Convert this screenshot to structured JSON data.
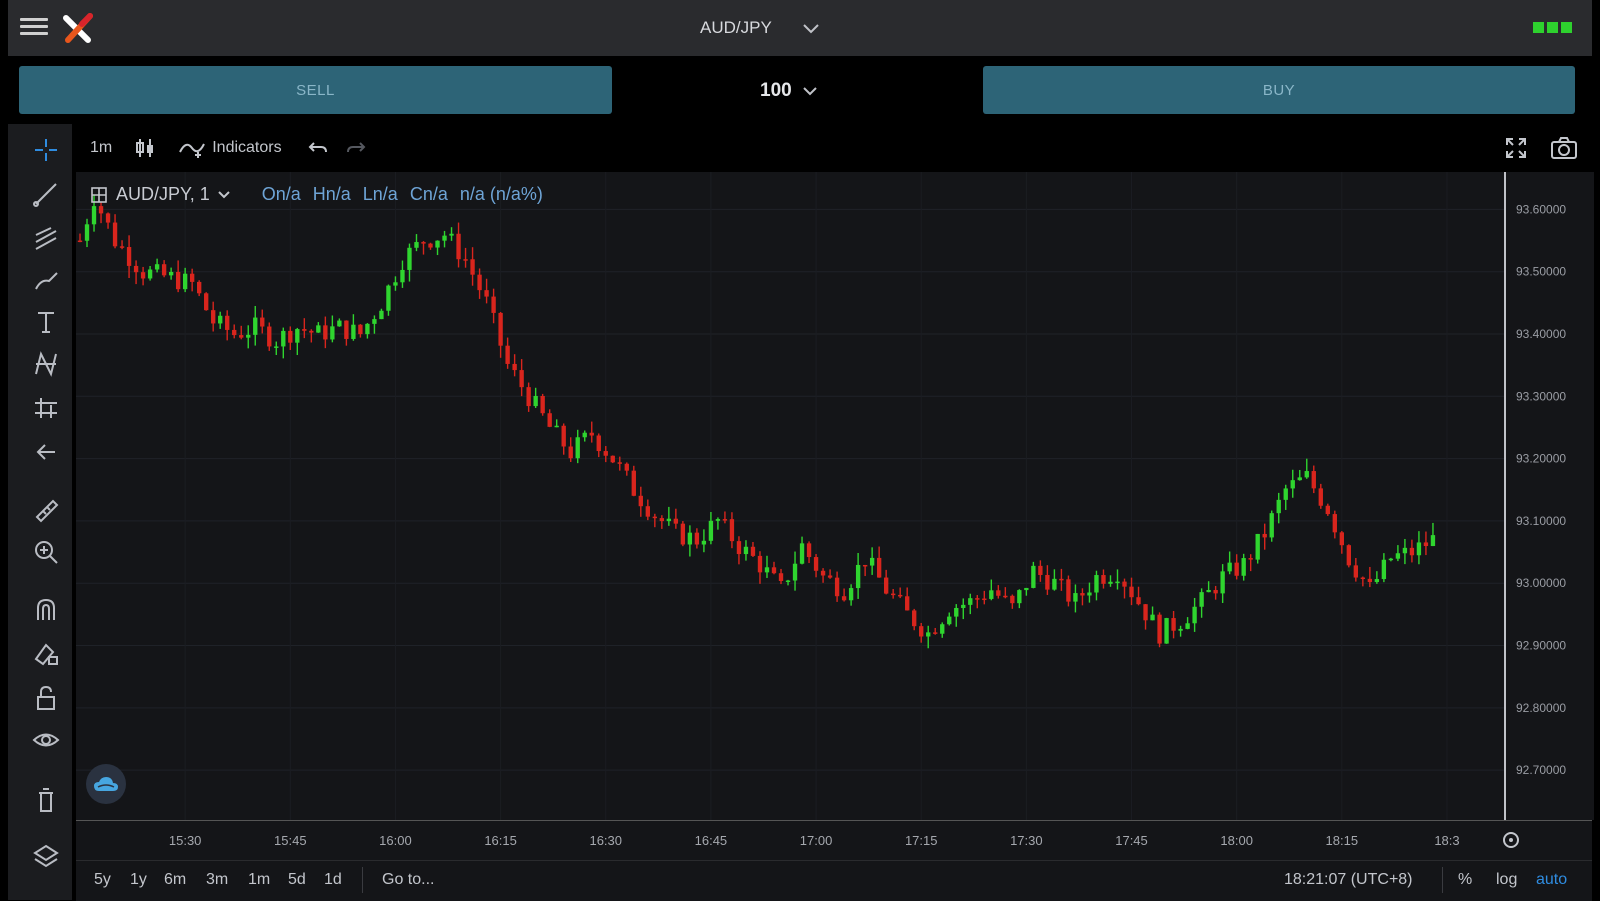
{
  "header": {
    "pair": "AUD/JPY",
    "colors": {
      "bar_bg": "#2a2b2e",
      "status": "#2ed12e"
    }
  },
  "trade": {
    "sell_label": "SELL",
    "buy_label": "BUY",
    "quantity": "100",
    "button_color": "#2d6477"
  },
  "chart_toolbar": {
    "interval": "1m",
    "indicators_label": "Indicators"
  },
  "legend": {
    "symbol": "AUD/JPY, 1",
    "open": "On/a",
    "high": "Hn/a",
    "low": "Ln/a",
    "close": "Cn/a",
    "change": "n/a (n/a%)"
  },
  "left_tools": [
    "crosshair-icon",
    "trend-line-icon",
    "fib-icon",
    "brush-icon",
    "text-icon",
    "pattern-icon",
    "projection-icon",
    "back-arrow-icon",
    "ruler-icon",
    "zoom-in-icon",
    "magnet-icon",
    "draw-lock-icon",
    "lock-icon",
    "eye-icon",
    "trash-icon",
    "layers-icon"
  ],
  "bottom": {
    "ranges": [
      "5y",
      "1y",
      "6m",
      "3m",
      "1m",
      "5d",
      "1d"
    ],
    "goto_label": "Go to...",
    "time": "18:21:07 (UTC+8)",
    "percent_label": "%",
    "log_label": "log",
    "auto_label": "auto",
    "auto_color": "#2f8ce0"
  },
  "chart_data": {
    "type": "candlestick",
    "y_ticks": [
      92.7,
      92.8,
      92.9,
      93.0,
      93.1,
      93.2,
      93.3,
      93.4,
      93.5,
      93.6
    ],
    "y_tick_labels": [
      "92.70000",
      "92.80000",
      "92.90000",
      "93.00000",
      "93.10000",
      "93.20000",
      "93.30000",
      "93.40000",
      "93.50000",
      "93.60000"
    ],
    "ylim": [
      92.62,
      93.66
    ],
    "x_ticks": [
      "15:30",
      "15:45",
      "16:00",
      "16:15",
      "16:30",
      "16:45",
      "17:00",
      "17:15",
      "17:30",
      "17:45",
      "18:00",
      "18:15",
      "18:3"
    ],
    "x_tick_positions_min": [
      15,
      30,
      45,
      60,
      75,
      90,
      105,
      120,
      135,
      150,
      165,
      180,
      195
    ],
    "xlim_min": [
      0,
      198
    ],
    "up_color": "#2fd52f",
    "down_color": "#d9251d",
    "grid": true,
    "close_path": [
      [
        0,
        93.55
      ],
      [
        2,
        93.62
      ],
      [
        5,
        93.55
      ],
      [
        9,
        93.5
      ],
      [
        13,
        93.49
      ],
      [
        16,
        93.48
      ],
      [
        19,
        93.42
      ],
      [
        22,
        93.4
      ],
      [
        25,
        93.41
      ],
      [
        28,
        93.39
      ],
      [
        31,
        93.41
      ],
      [
        34,
        93.4
      ],
      [
        37,
        93.41
      ],
      [
        40,
        93.4
      ],
      [
        43,
        93.45
      ],
      [
        46,
        93.52
      ],
      [
        49,
        93.55
      ],
      [
        52,
        93.56
      ],
      [
        55,
        93.52
      ],
      [
        58,
        93.45
      ],
      [
        61,
        93.35
      ],
      [
        64,
        93.3
      ],
      [
        67,
        93.25
      ],
      [
        70,
        93.21
      ],
      [
        73,
        93.24
      ],
      [
        76,
        93.2
      ],
      [
        79,
        93.15
      ],
      [
        82,
        93.11
      ],
      [
        85,
        93.08
      ],
      [
        88,
        93.07
      ],
      [
        91,
        93.1
      ],
      [
        94,
        93.06
      ],
      [
        97,
        93.03
      ],
      [
        100,
        92.99
      ],
      [
        103,
        93.06
      ],
      [
        106,
        93.01
      ],
      [
        109,
        92.99
      ],
      [
        112,
        93.04
      ],
      [
        115,
        92.99
      ],
      [
        118,
        92.95
      ],
      [
        121,
        92.92
      ],
      [
        124,
        92.96
      ],
      [
        127,
        92.97
      ],
      [
        130,
        92.99
      ],
      [
        133,
        92.96
      ],
      [
        136,
        93.02
      ],
      [
        139,
        93.0
      ],
      [
        142,
        92.97
      ],
      [
        145,
        93.01
      ],
      [
        148,
        93.02
      ],
      [
        151,
        92.97
      ],
      [
        154,
        92.92
      ],
      [
        157,
        92.94
      ],
      [
        160,
        92.97
      ],
      [
        163,
        93.01
      ],
      [
        166,
        93.03
      ],
      [
        169,
        93.08
      ],
      [
        172,
        93.15
      ],
      [
        175,
        93.17
      ],
      [
        178,
        93.12
      ],
      [
        181,
        93.04
      ],
      [
        184,
        92.99
      ],
      [
        187,
        93.04
      ],
      [
        190,
        93.05
      ],
      [
        193,
        93.07
      ]
    ]
  }
}
